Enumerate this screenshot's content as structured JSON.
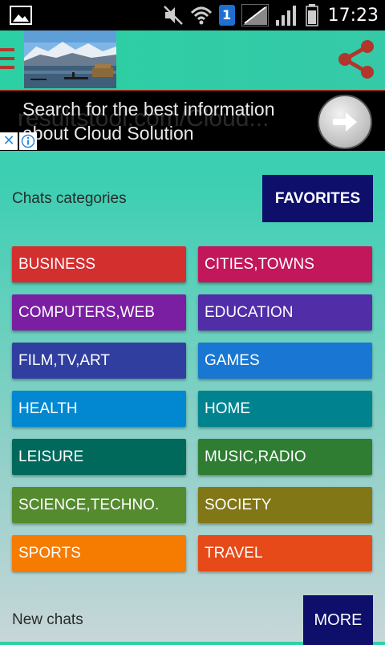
{
  "status_bar": {
    "time": "17:23",
    "icons": [
      "image-icon",
      "mute-icon",
      "wifi-icon",
      "sim1-icon",
      "signal-icon",
      "signal-icon",
      "battery-icon"
    ],
    "sim_number": "1"
  },
  "app_bar": {
    "icons": [
      "hamburger-icon",
      "share-icon"
    ],
    "accent_color": "#b3362c"
  },
  "ad": {
    "text": "Search for the best information about Cloud Solution",
    "ghost_text": "resultstool.com/Cloud..."
  },
  "categories_section": {
    "title": "Chats categories",
    "favorites_label": "FAVORITES",
    "items": [
      {
        "label": "BUSINESS",
        "color": "#d32f2f"
      },
      {
        "label": "CITIES,TOWNS",
        "color": "#c2185b"
      },
      {
        "label": "COMPUTERS,WEB",
        "color": "#7b1fa2"
      },
      {
        "label": "EDUCATION",
        "color": "#512da8"
      },
      {
        "label": "FILM,TV,ART",
        "color": "#303f9f"
      },
      {
        "label": "GAMES",
        "color": "#1976d2"
      },
      {
        "label": "HEALTH",
        "color": "#0288d1"
      },
      {
        "label": "HOME",
        "color": "#00838f"
      },
      {
        "label": "LEISURE",
        "color": "#00695c"
      },
      {
        "label": "MUSIC,RADIO",
        "color": "#2e7d32"
      },
      {
        "label": "SCIENCE,TECHNO.",
        "color": "#558b2f"
      },
      {
        "label": "SOCIETY",
        "color": "#827717"
      },
      {
        "label": "SPORTS",
        "color": "#f57c00"
      },
      {
        "label": "TRAVEL",
        "color": "#e64a19"
      }
    ]
  },
  "new_chats_section": {
    "title": "New chats",
    "more_label": "MORE"
  }
}
